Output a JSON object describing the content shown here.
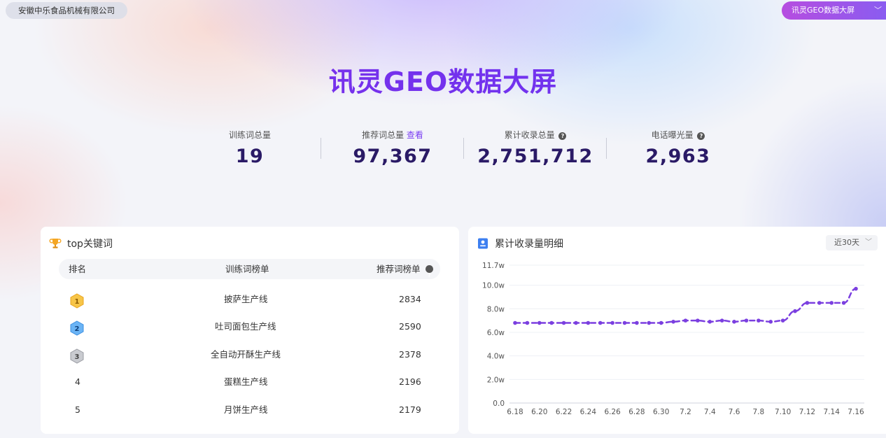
{
  "header": {
    "company": "安徽中乐食品机械有限公司",
    "screen_select": "讯灵GEO数据大屏",
    "title": "讯灵GEO数据大屏"
  },
  "stats": [
    {
      "label": "训练词总量",
      "value": "19"
    },
    {
      "label": "推荐词总量",
      "link": "查看",
      "value": "97,367"
    },
    {
      "label": "累计收录总量",
      "value": "2,751,712"
    },
    {
      "label": "电话曝光量",
      "value": "2,963"
    }
  ],
  "top_keywords": {
    "title": "top关键词",
    "columns": {
      "rank": "排名",
      "train": "训练词榜单",
      "recommend": "推荐词榜单"
    },
    "rows": [
      {
        "rank": "1",
        "name": "披萨生产线",
        "count": "2834",
        "medal": "gold"
      },
      {
        "rank": "2",
        "name": "吐司面包生产线",
        "count": "2590",
        "medal": "blue"
      },
      {
        "rank": "3",
        "name": "全自动开酥生产线",
        "count": "2378",
        "medal": "silver"
      },
      {
        "rank": "4",
        "name": "蛋糕生产线",
        "count": "2196",
        "medal": ""
      },
      {
        "rank": "5",
        "name": "月饼生产线",
        "count": "2179",
        "medal": ""
      }
    ]
  },
  "collection_detail": {
    "title": "累计收录量明细",
    "range": "近30天"
  },
  "chart_data": {
    "type": "line",
    "title": "",
    "xlabel": "",
    "ylabel": "",
    "y_tick_labels": [
      "0.0",
      "2.0w",
      "4.0w",
      "6.0w",
      "8.0w",
      "10.0w",
      "11.7w"
    ],
    "y_ticks": [
      0,
      2.0,
      4.0,
      6.0,
      8.0,
      10.0,
      11.7
    ],
    "ylim": [
      0,
      11.7
    ],
    "x_tick_labels": [
      "6.18",
      "6.20",
      "6.22",
      "6.24",
      "6.26",
      "6.28",
      "6.30",
      "7.2",
      "7.4",
      "7.6",
      "7.8",
      "7.10",
      "7.12",
      "7.14",
      "7.16"
    ],
    "x": [
      "6.18",
      "6.19",
      "6.20",
      "6.21",
      "6.22",
      "6.23",
      "6.24",
      "6.25",
      "6.26",
      "6.27",
      "6.28",
      "6.29",
      "6.30",
      "7.1",
      "7.2",
      "7.3",
      "7.4",
      "7.5",
      "7.6",
      "7.7",
      "7.8",
      "7.9",
      "7.10",
      "7.11",
      "7.12",
      "7.13",
      "7.14",
      "7.15",
      "7.16"
    ],
    "values": [
      6.8,
      6.8,
      6.8,
      6.8,
      6.8,
      6.8,
      6.8,
      6.8,
      6.8,
      6.8,
      6.8,
      6.8,
      6.8,
      6.9,
      7.0,
      7.0,
      6.9,
      7.0,
      6.9,
      7.0,
      7.0,
      6.9,
      7.0,
      7.8,
      8.5,
      8.5,
      8.5,
      8.5,
      9.7
    ],
    "color": "#7b3fe0",
    "grid": true
  }
}
